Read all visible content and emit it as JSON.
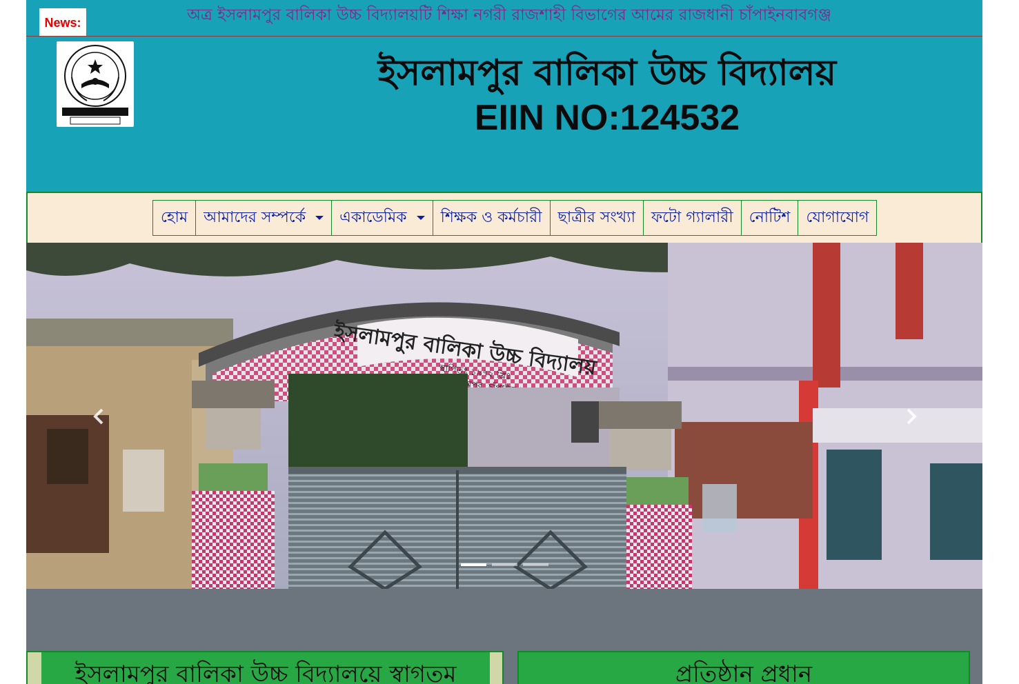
{
  "news": {
    "label": "News:",
    "ticker": "অত্র ইসলামপুর বালিকা উচ্চ বিদ্যালয়টি শিক্ষা নগরী রাজশাহী বিভাগের আমের রাজধানী চাঁপাইনবাবগঞ্জ"
  },
  "header": {
    "title": "ইসলামপুর বালিকা উচ্চ বিদ্যালয়",
    "eiin": "EIIN NO:124532",
    "logo_icon": "school-seal-logo"
  },
  "nav": {
    "items": [
      {
        "label": "হোম",
        "dropdown": false
      },
      {
        "label": "আমাদের সম্পর্কে",
        "dropdown": true
      },
      {
        "label": "একাডেমিক",
        "dropdown": true
      },
      {
        "label": "শিক্ষক ও কর্মচারী",
        "dropdown": false
      },
      {
        "label": "ছাত্রীর সংখ্যা",
        "dropdown": false
      },
      {
        "label": "ফটো গ্যালারী",
        "dropdown": false
      },
      {
        "label": "নোটিশ",
        "dropdown": false
      },
      {
        "label": "যোগাযোগ",
        "dropdown": false
      }
    ]
  },
  "slider": {
    "gate_sign": "ইসলামপুর বালিকা উচ্চ বিদ্যালয়",
    "gate_sub1": "স্থাপিতঃ ১৯৭২ খ্রিঃ",
    "gate_sub2": "ডাকঃ ইসলামপুর, চাঁপাইনবাবগঞ্জ",
    "active_index": 0,
    "count": 3
  },
  "sections": {
    "welcome_title": "ইসলামপুর বালিকা উচ্চ বিদ্যালয়ে স্বাগতম",
    "head_title": "প্রতিষ্ঠান প্রধান"
  },
  "colors": {
    "header_bg": "#17a2b8",
    "nav_bg": "#faebd7",
    "nav_border": "#108a2a",
    "nav_text": "#0a1fa8",
    "news_text": "#7a2a8a",
    "box_green": "#28a745"
  }
}
